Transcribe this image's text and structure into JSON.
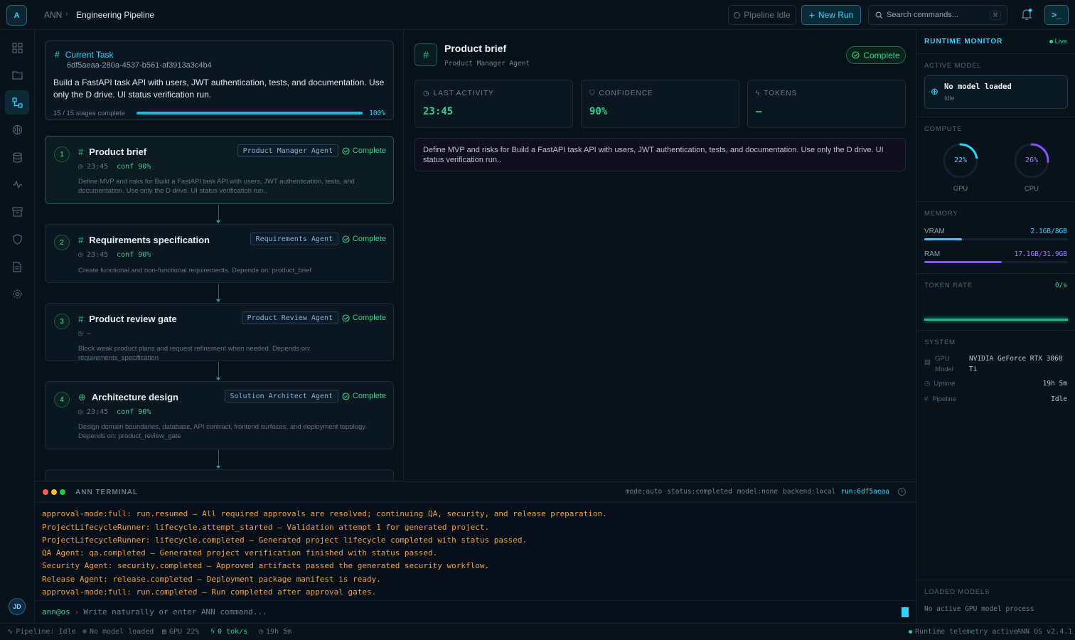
{
  "app": {
    "logo": "A",
    "breadcrumb_root": "ANN",
    "breadcrumb_current": "Engineering Pipeline"
  },
  "header": {
    "pipeline_status": "Pipeline Idle",
    "new_run": "New Run",
    "search_placeholder": "Search commands...",
    "search_shortcut": "⌘"
  },
  "sidebar": {
    "items": [
      "dashboard-icon",
      "folder-icon",
      "pipeline-icon",
      "brain-icon",
      "database-icon",
      "activity-icon",
      "archive-icon",
      "shield-icon",
      "document-icon",
      "gear-icon"
    ],
    "active": "pipeline-icon",
    "avatar": "JD"
  },
  "task": {
    "label": "Current Task",
    "id": "6df5aeaa-280a-4537-b561-af3913a3c4b4",
    "description": "Build a FastAPI task API with users, JWT authentication, tests, and documentation. Use only the D drive. UI status verification run.",
    "progress_text": "15 / 15 stages complete",
    "progress_pct": "100%",
    "progress_fraction": 1.0
  },
  "stages": [
    {
      "num": "1",
      "title": "Product brief",
      "agent": "Product Manager Agent",
      "status": "Complete",
      "time": "23:45",
      "conf": "conf 90%",
      "desc": "Define MVP and risks for Build a FastAPI task API with users, JWT authentication, tests, and documentation. Use only the D drive. UI status verification run.."
    },
    {
      "num": "2",
      "title": "Requirements specification",
      "agent": "Requirements Agent",
      "status": "Complete",
      "time": "23:45",
      "conf": "conf 90%",
      "desc": "Create functional and non-functional requirements. Depends on: product_brief"
    },
    {
      "num": "3",
      "title": "Product review gate",
      "agent": "Product Review Agent",
      "status": "Complete",
      "time": "–",
      "conf": "",
      "desc": "Block weak product plans and request refinement when needed. Depends on: requirements_specification"
    },
    {
      "num": "4",
      "title": "Architecture design",
      "agent": "Solution Architect Agent",
      "status": "Complete",
      "time": "23:45",
      "conf": "conf 90%",
      "desc": "Design domain boundaries, database, API contract, frontend surfaces, and deployment topology. Depends on: product_review_gate"
    }
  ],
  "detail": {
    "title": "Product brief",
    "agent": "Product Manager Agent",
    "status": "Complete",
    "last_activity_label": "LAST ACTIVITY",
    "last_activity": "23:45",
    "confidence_label": "CONFIDENCE",
    "confidence": "90%",
    "tokens_label": "TOKENS",
    "tokens": "–",
    "description": "Define MVP and risks for Build a FastAPI task API with users, JWT authentication, tests, and documentation. Use only the D drive. UI status verification run.."
  },
  "monitor": {
    "title": "RUNTIME MONITOR",
    "live": "Live",
    "active_model_label": "ACTIVE MODEL",
    "model_name": "No model loaded",
    "model_state": "Idle",
    "compute_label": "COMPUTE",
    "gpu_pct": "22%",
    "gpu_label": "GPU",
    "gpu_fraction": 0.22,
    "cpu_pct": "26%",
    "cpu_label": "CPU",
    "cpu_fraction": 0.26,
    "memory_label": "MEMORY",
    "vram_label": "VRAM",
    "vram_value": "2.1GB/8GB",
    "vram_fraction": 0.26,
    "ram_label": "RAM",
    "ram_value": "17.1GB/31.9GB",
    "ram_fraction": 0.54,
    "token_rate_label": "TOKEN RATE",
    "token_rate": "0/s",
    "system_label": "SYSTEM",
    "gpu_model_label": "GPU Model",
    "gpu_model": "NVIDIA GeForce RTX 3060 Ti",
    "uptime_label": "Uptime",
    "uptime": "19h 5m",
    "pipeline_label": "Pipeline",
    "pipeline": "Idle",
    "loaded_models_label": "LOADED MODELS",
    "loaded_models": "No active GPU model process"
  },
  "terminal": {
    "title": "ANN TERMINAL",
    "mode": "mode:auto",
    "status": "status:completed",
    "model": "model:none",
    "backend": "backend:local",
    "run": "run:6df5aeaa",
    "lines": [
      "approval-mode:full: run.resumed — All required approvals are resolved; continuing QA, security, and release preparation.",
      "ProjectLifecycleRunner: lifecycle.attempt_started — Validation attempt 1 for generated project.",
      "ProjectLifecycleRunner: lifecycle.completed — Generated project lifecycle completed with status passed.",
      "QA Agent: qa.completed — Generated project verification finished with status passed.",
      "Security Agent: security.completed — Approved artifacts passed the generated security workflow.",
      "Release Agent: release.completed — Deployment package manifest is ready.",
      "approval-mode:full: run.completed — Run completed after approval gates."
    ],
    "prompt": "ann@os",
    "placeholder": "Write naturally or enter ANN command..."
  },
  "statusbar": {
    "pipeline": "Pipeline: Idle",
    "model": "No model loaded",
    "gpu": "GPU 22%",
    "tok": "0 tok/s",
    "uptime": "19h 5m",
    "telemetry": "Runtime telemetry active",
    "version": "ANN OS v2.4.1"
  }
}
